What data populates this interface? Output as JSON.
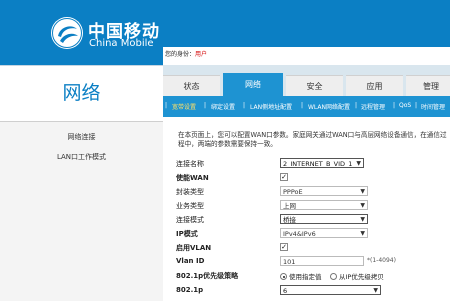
{
  "brand": {
    "name_cn": "中国移动",
    "name_en": "China Mobile"
  },
  "identity": {
    "label": "您的身份：",
    "value": "用户"
  },
  "section_title": "网络",
  "sidebar": {
    "items": [
      {
        "label": "网络连接"
      },
      {
        "label": "LAN口工作模式"
      }
    ]
  },
  "tabs": [
    {
      "label": "状态"
    },
    {
      "label": "网络"
    },
    {
      "label": "安全"
    },
    {
      "label": "应用"
    },
    {
      "label": "管理"
    }
  ],
  "subnav": [
    {
      "label": "宽带设置"
    },
    {
      "label": "绑定设置"
    },
    {
      "label": "LAN侧地址配置"
    },
    {
      "label": "WLAN网络配置"
    },
    {
      "label": "远程管理"
    },
    {
      "label": "QoS"
    },
    {
      "label": "时间管理"
    }
  ],
  "description": "在本页面上，您可以配置WAN口参数。家庭网关通过WAN口与高层网络设备通信，在通信过程中，两端的参数需要保持一致。",
  "form": {
    "connection_name": {
      "label": "连接名称",
      "value": "2_INTERNET_B_VID_1"
    },
    "enable_wan": {
      "label": "使能WAN"
    },
    "encap_type": {
      "label": "封装类型",
      "value": "PPPoE"
    },
    "service_type": {
      "label": "业务类型",
      "value": "上网"
    },
    "conn_mode": {
      "label": "连接模式",
      "value": "桥接"
    },
    "ip_mode": {
      "label": "IP模式",
      "value": "IPv4&IPv6"
    },
    "enable_vlan": {
      "label": "启用VLAN"
    },
    "vlan_id": {
      "label": "Vlan ID",
      "value": "101",
      "hint": "*(1-4094)"
    },
    "prio_policy": {
      "label": "802.1p优先级策略",
      "option1": "使用指定值",
      "option2": "从IP优先级拷贝"
    },
    "p8021": {
      "label": "802.1p",
      "value": "6"
    }
  },
  "colors": {
    "brand_blue": "#0b7fc4",
    "nav_blue": "#1e93d2",
    "highlight": "#ffe066",
    "identity_red": "#d40000"
  }
}
